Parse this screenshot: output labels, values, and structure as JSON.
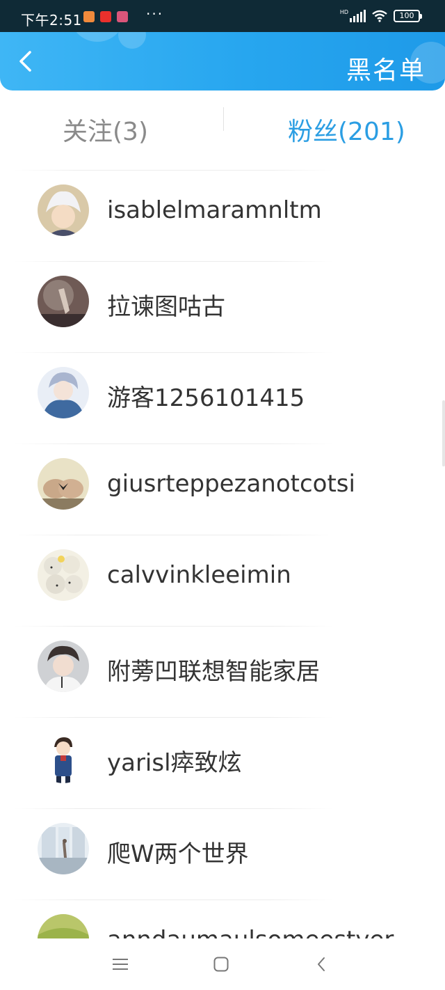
{
  "status_bar": {
    "time": "下午2:51",
    "more": "···",
    "hd": "HD",
    "battery": "100"
  },
  "header": {
    "title": "黑名单",
    "back_icon": "chevron-left-icon"
  },
  "tabs": [
    {
      "label": "关注(3)",
      "active": false
    },
    {
      "label": "粉丝(201)",
      "active": true
    }
  ],
  "users": [
    {
      "name": "isablelmaramnltm",
      "avatar_color": "#d9c9a8"
    },
    {
      "name": "拉谏图咕古",
      "avatar_color": "#6f5a55"
    },
    {
      "name": "游客1256101415",
      "avatar_color": "#3f6aa0"
    },
    {
      "name": "giusrteppezanotcotsi",
      "avatar_color": "#c9a889"
    },
    {
      "name": "calvvinkleeimin",
      "avatar_color": "#e6e3d8"
    },
    {
      "name": "附蒡凹联想智能家居",
      "avatar_color": "#8c8f94"
    },
    {
      "name": "yarisl瘁致炫",
      "avatar_color": "#2d4f8a"
    },
    {
      "name": "爬W两个世界",
      "avatar_color": "#c8d3de"
    },
    {
      "name": "anndaumaulsomeestyer",
      "avatar_color": "#9bb34a"
    }
  ],
  "colors": {
    "accent": "#2b9ee3",
    "header_gradient_start": "#3fb6f5",
    "header_gradient_end": "#1e9ae8",
    "inactive_tab": "#8a8a8a"
  },
  "navbar": {
    "menu_icon": "menu-icon",
    "home_icon": "home-square-icon",
    "back_icon": "back-triangle-icon"
  }
}
